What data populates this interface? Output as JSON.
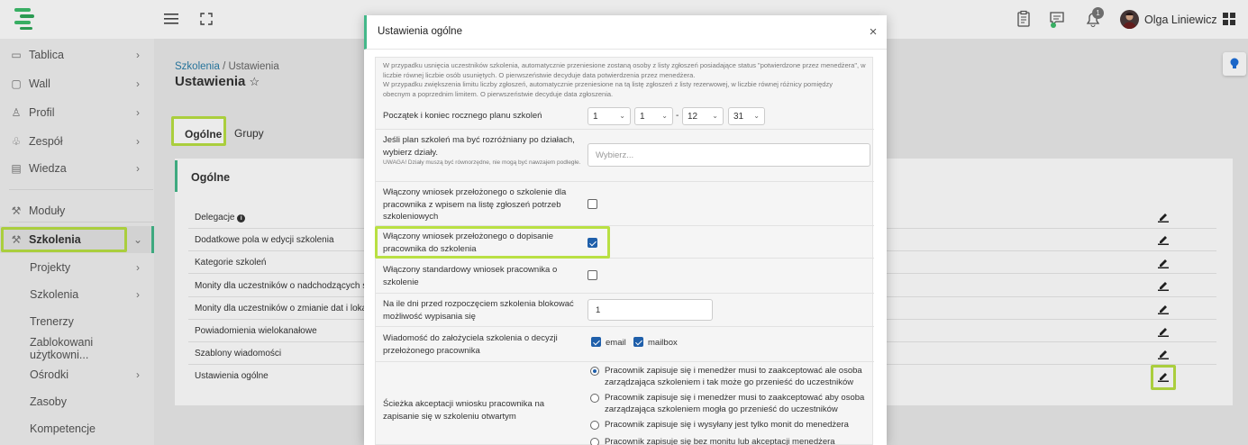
{
  "topbar": {
    "user_name": "Olga Liniewicz",
    "notification_count": "1"
  },
  "sidebar": {
    "items": [
      {
        "label": "Tablica"
      },
      {
        "label": "Wall"
      },
      {
        "label": "Profil"
      },
      {
        "label": "Zespół"
      },
      {
        "label": "Wiedza"
      },
      {
        "label": "Moduły"
      },
      {
        "label": "Szkolenia"
      },
      {
        "label": "Projekty"
      },
      {
        "label": "Szkolenia"
      },
      {
        "label": "Trenerzy"
      },
      {
        "label": "Zablokowani użytkowni..."
      },
      {
        "label": "Ośrodki"
      },
      {
        "label": "Zasoby"
      },
      {
        "label": "Kompetencje"
      }
    ]
  },
  "breadcrumb": {
    "link": "Szkolenia",
    "separator": " / ",
    "current": "Ustawienia"
  },
  "page": {
    "title": "Ustawienia",
    "tabs": [
      "Ogólne",
      "Grupy"
    ],
    "card_title": "Ogólne",
    "rows": [
      "Delegacje",
      "Dodatkowe pola w edycji szkolenia",
      "Kategorie szkoleń",
      "Monity dla uczestników o nadchodzących szko",
      "Monity dla uczestników o zmianie dat i lokaliz",
      "Powiadomienia wielokanałowe",
      "Szablony wiadomości",
      "Ustawienia ogólne"
    ]
  },
  "modal": {
    "title": "Ustawienia ogólne",
    "close": "×",
    "info_lines": [
      "W przypadku usnięcia uczestników szkolenia, automatycznie przeniesione zostaną osoby z listy zgłoszeń posiadające status \"potwierdzone przez menedżera\", w",
      "liczbie równej liczbie osób usuniętych. O pierwszeństwie decyduje data potwierdzenia przez menedżera.",
      "W przypadku zwiększenia limitu liczby zgłoszeń, automatycznie przeniesione na tą listę zgłoszeń z listy rezerwowej, w liczbie równej różnicy pomiędzy",
      "obecnym a poprzednim limitem. O pierwszeństwie decyduje data zgłoszenia."
    ],
    "plan_label": "Początek i koniec rocznego planu szkoleń",
    "plan_selects": [
      "1",
      "1",
      "12",
      "31"
    ],
    "plan_dash": "-",
    "divisions_label": "Jeśli plan szkoleń ma być rozróżniany po działach, wybierz działy.",
    "divisions_note": "UWAGA! Działy muszą być równorzędne, nie mogą być nawzajem podległe.",
    "divisions_placeholder": "Wybierz...",
    "superior_label": "Włączony wniosek przełożonego o szkolenie dla pracownika z wpisem na listę zgłoszeń potrzeb szkoleniowych",
    "superior_checked": false,
    "superior_add_label": "Włączony wniosek przełożonego o dopisanie pracownika do szkolenia",
    "superior_add_checked": true,
    "standard_label": "Włączony standardowy wniosek pracownika o szkolenie",
    "standard_checked": false,
    "days_label": "Na ile dni przed rozpoczęciem szkolenia blokować możliwość wypisania się",
    "days_value": "1",
    "message_label": "Wiadomość do założyciela szkolenia o decyzji przełożonego pracownika",
    "message_email": "email",
    "message_mailbox": "mailbox",
    "path_label": "Ścieżka akceptacji wniosku pracownika na zapisanie się w szkoleniu otwartym",
    "path_options": [
      "Pracownik zapisuje się i menedżer musi to zaakceptować ale osoba zarządzająca szkoleniem i tak może go przenieść do uczestników",
      "Pracownik zapisuje się i menedżer musi to zaakceptować aby osoba zarządzająca szkoleniem mogła go przenieść do uczestników",
      "Pracownik zapisuje się i wysyłany jest tylko monit do menedżera",
      "Pracownik zapisuje się bez monitu lub akceptacji menedżera"
    ]
  },
  "colors": {
    "accent_green": "#44b88a",
    "highlight": "#b9e043",
    "link": "#2a7da8",
    "checkbox": "#1f5faa"
  }
}
